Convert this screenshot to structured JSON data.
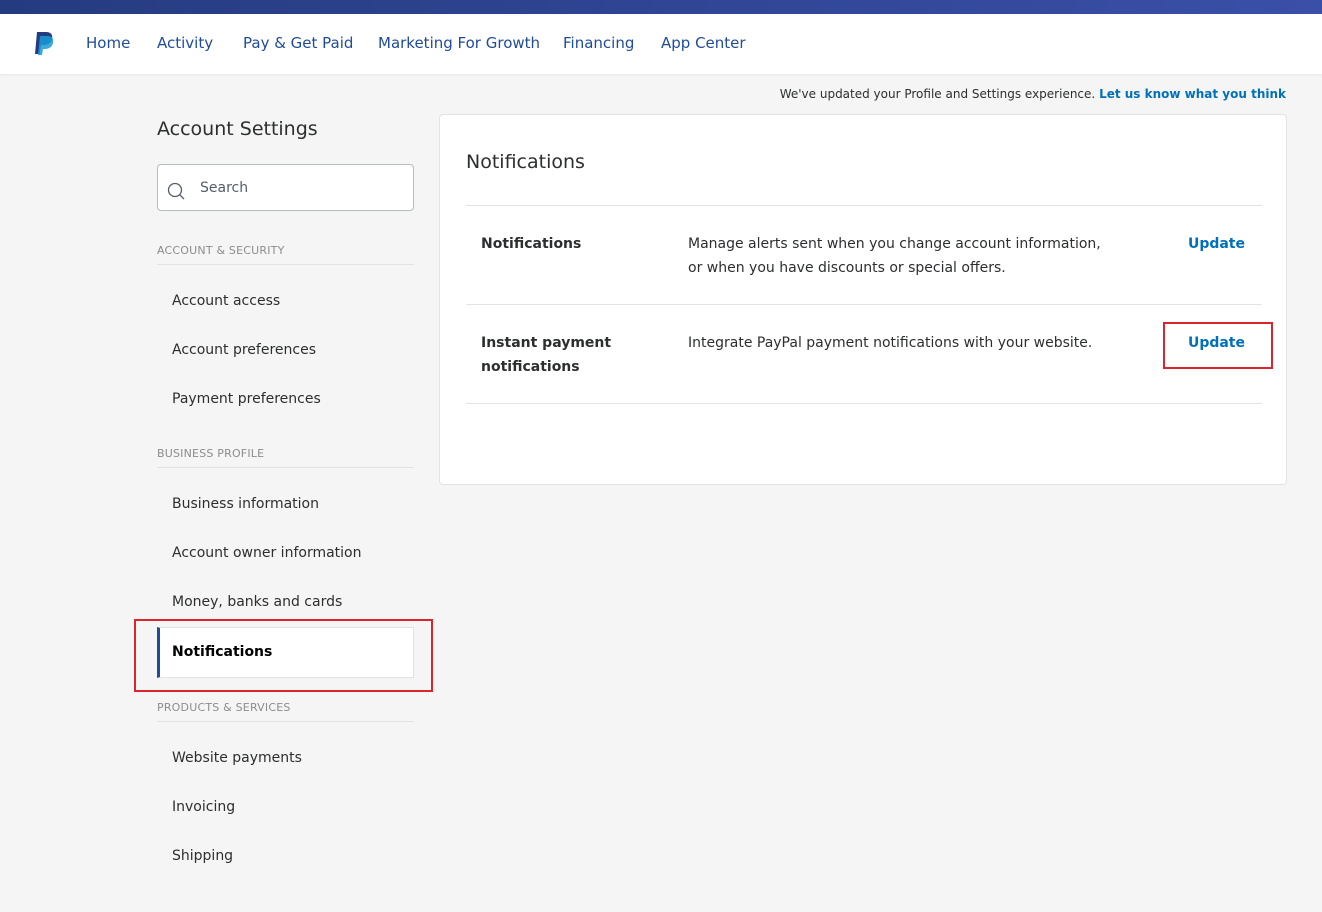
{
  "colors": {
    "brand_dark": "#253b80",
    "nav_link": "#1f4b99",
    "link": "#0070ba",
    "highlight": "#d9262c"
  },
  "logo": {
    "icon": "paypal-logo-icon"
  },
  "nav": {
    "items": [
      "Home",
      "Activity",
      "Pay & Get Paid",
      "Marketing For Growth",
      "Financing",
      "App Center"
    ]
  },
  "notice": {
    "text": "We've updated your Profile and Settings experience.",
    "link": "Let us know what you think"
  },
  "sidebar": {
    "title": "Account Settings",
    "search": {
      "placeholder": "Search",
      "value": "",
      "icon": "search-icon"
    },
    "sections": [
      {
        "heading": "ACCOUNT & SECURITY",
        "items": [
          "Account access",
          "Account preferences",
          "Payment preferences"
        ]
      },
      {
        "heading": "BUSINESS PROFILE",
        "items": [
          "Business information",
          "Account owner information",
          "Money, banks and cards",
          "Notifications"
        ]
      },
      {
        "heading": "PRODUCTS & SERVICES",
        "items": [
          "Website payments",
          "Invoicing",
          "Shipping"
        ]
      }
    ],
    "active_item": "Notifications"
  },
  "main": {
    "title": "Notifications",
    "rows": [
      {
        "label": "Notifications",
        "description": "Manage alerts sent when you change account information, or when you have discounts or special offers.",
        "action": "Update"
      },
      {
        "label": "Instant payment notifications",
        "description": "Integrate PayPal payment notifications with your website.",
        "action": "Update"
      }
    ]
  }
}
